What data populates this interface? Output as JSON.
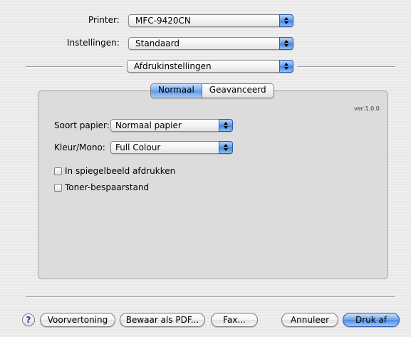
{
  "printer": {
    "label": "Printer:",
    "value": "MFC-9420CN"
  },
  "settings": {
    "label": "Instellingen:",
    "value": "Standaard"
  },
  "section": {
    "value": "Afdrukinstellingen"
  },
  "tabs": [
    {
      "label": "Normaal",
      "selected": true
    },
    {
      "label": "Geavanceerd",
      "selected": false
    }
  ],
  "version": "ver:1.0.0",
  "paper_type": {
    "label": "Soort papier:",
    "value": "Normaal papier"
  },
  "color_mode": {
    "label": "Kleur/Mono:",
    "value": "Full Colour"
  },
  "checkboxes": [
    {
      "label": "In spiegelbeeld afdrukken",
      "checked": false
    },
    {
      "label": "Toner-bespaarstand",
      "checked": false
    }
  ],
  "buttons": {
    "help": "?",
    "preview": "Voorvertoning",
    "save_pdf": "Bewaar als PDF...",
    "fax": "Fax...",
    "cancel": "Annuleer",
    "print": "Druk af"
  },
  "colors": {
    "accent": "#5a95e6",
    "background": "#ececec",
    "panel": "#dcdcdc"
  }
}
